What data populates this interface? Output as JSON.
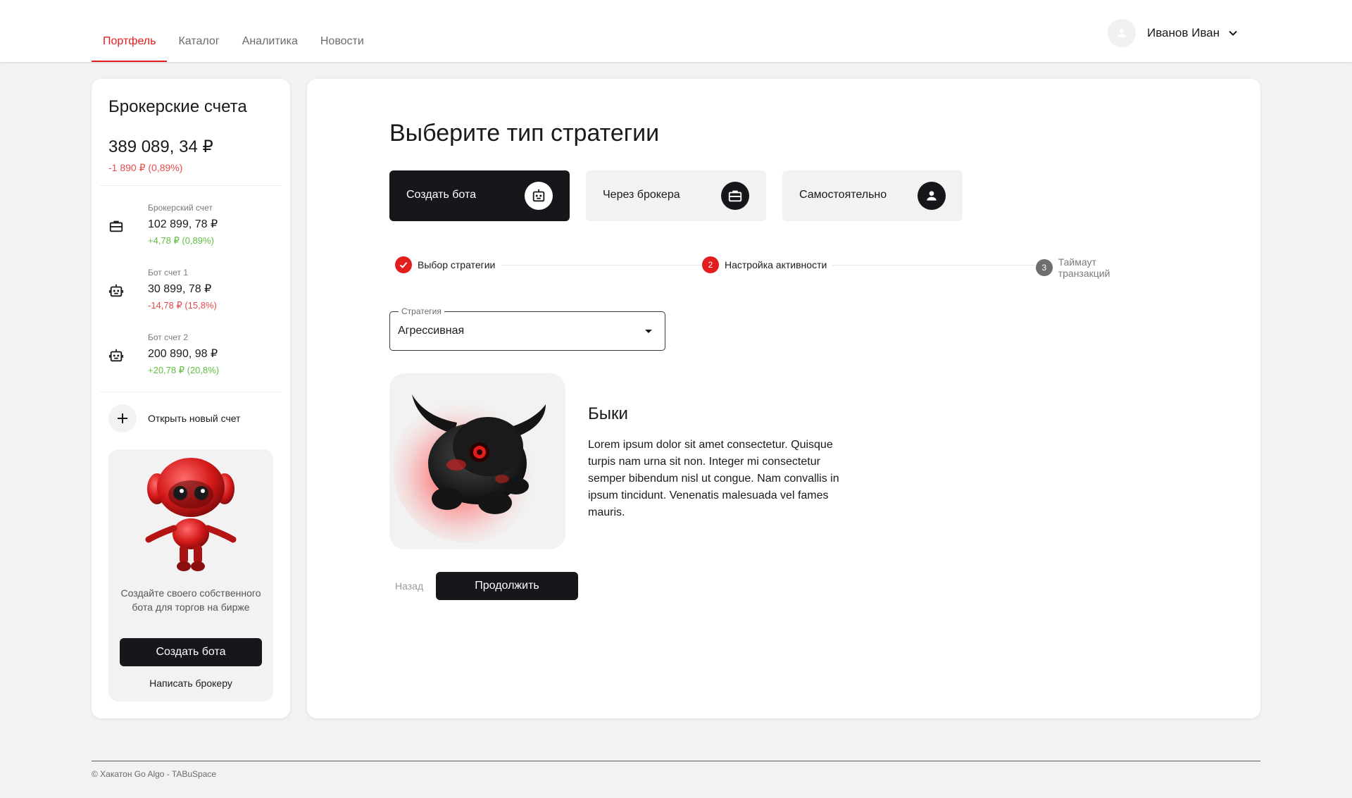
{
  "nav": {
    "items": [
      {
        "label": "Портфель",
        "active": true
      },
      {
        "label": "Каталог",
        "active": false
      },
      {
        "label": "Аналитика",
        "active": false
      },
      {
        "label": "Новости",
        "active": false
      }
    ]
  },
  "user": {
    "name": "Иванов Иван",
    "avatar_icon": "person-icon",
    "menu_icon": "chevron-down-icon"
  },
  "sidebar": {
    "title": "Брокерские счета",
    "total": "389 089, 34 ₽",
    "total_change": "-1 890 ₽ (0,89%)",
    "accounts": [
      {
        "label": "Брокерский счет",
        "value": "102 899, 78 ₽",
        "change": "+4,78 ₽ (0,89%)",
        "trend": "up",
        "icon": "briefcase-icon"
      },
      {
        "label": "Бот счет 1",
        "value": "30 899, 78 ₽",
        "change": "-14,78 ₽ (15,8%)",
        "trend": "down",
        "icon": "robot-icon"
      },
      {
        "label": "Бот счет 2",
        "value": "200 890, 98 ₽",
        "change": "+20,78 ₽ (20,8%)",
        "trend": "up",
        "icon": "robot-icon"
      }
    ],
    "open_account": "Открыть новый счет",
    "promo": {
      "text": "Создайте своего собственного бота для торгов на бирже",
      "button": "Создать бота",
      "link": "Написать брокеру"
    }
  },
  "main": {
    "title": "Выберите тип стратегии",
    "strategy_types": [
      {
        "label": "Создать бота",
        "icon": "robot-icon",
        "selected": true
      },
      {
        "label": "Через брокера",
        "icon": "briefcase-icon",
        "selected": false
      },
      {
        "label": "Самостоятельно",
        "icon": "person-icon",
        "selected": false
      }
    ],
    "steps": [
      {
        "number": "",
        "label": "Выбор стратегии",
        "state": "done"
      },
      {
        "number": "2",
        "label": "Настройка активности",
        "state": "active"
      },
      {
        "number": "3",
        "label": "Таймаут транзакций",
        "state": "todo"
      }
    ],
    "strategy_select": {
      "label": "Стратегия",
      "value": "Агрессивная"
    },
    "result": {
      "title": "Быки",
      "description": "Lorem ipsum dolor sit amet consectetur. Quisque turpis nam urna sit non. Integer mi consectetur semper bibendum nisl ut congue. Nam convallis in ipsum tincidunt. Venenatis malesuada vel fames mauris."
    },
    "back": "Назад",
    "continue": "Продолжить"
  },
  "footer": {
    "text": "© Хакатон Go Algo - TABuSpace"
  },
  "colors": {
    "accent": "#e31d1d",
    "dark": "#15171b",
    "up": "#5fbf3f",
    "down": "#e84a4a"
  }
}
